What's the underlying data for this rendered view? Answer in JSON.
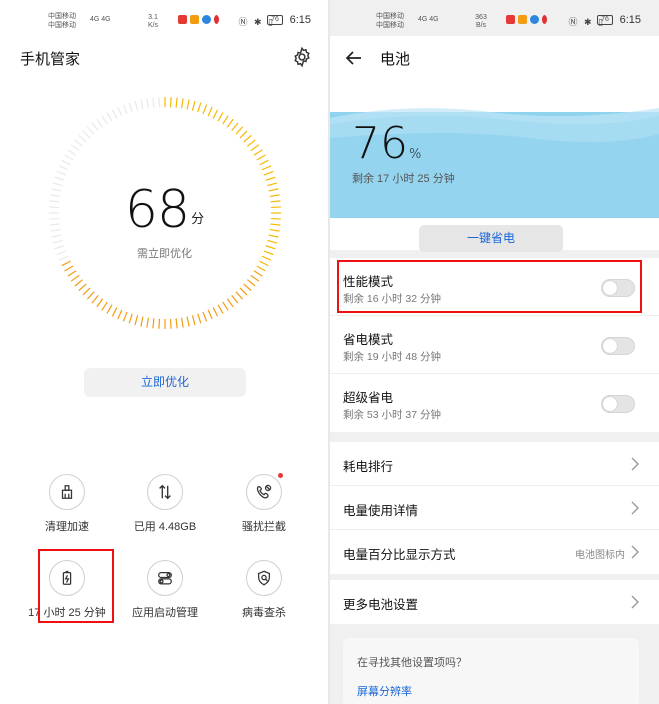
{
  "left": {
    "status": {
      "carrier_line1": "中国移动",
      "carrier_line2": "中国移动",
      "net": "4G 4G",
      "speed": "3.1\nK/s",
      "battery": "76",
      "time": "6:15"
    },
    "title": "手机管家",
    "score": {
      "value": "68",
      "unit": "分",
      "subtitle": "需立即优化"
    },
    "optimize_button": "立即优化",
    "tools": [
      {
        "label": "清理加速",
        "icon": "broom-icon"
      },
      {
        "label": "已用 4.48GB",
        "icon": "data-traffic-icon"
      },
      {
        "label": "骚扰拦截",
        "icon": "call-block-icon",
        "badge": true
      },
      {
        "label": "17 小时 25 分钟",
        "icon": "battery-icon"
      },
      {
        "label": "应用启动管理",
        "icon": "toggle-icon"
      },
      {
        "label": "病毒查杀",
        "icon": "shield-search-icon"
      }
    ],
    "score_ring": {
      "value": 68,
      "max": 100,
      "color_start": "#f5b800",
      "color_end": "#f39c12",
      "track_color": "#e9e9e9"
    }
  },
  "right": {
    "status": {
      "carrier_line1": "中国移动",
      "carrier_line2": "中国移动",
      "net": "4G 4G",
      "speed": "363\nB/s",
      "battery": "76",
      "time": "6:15"
    },
    "title": "电池",
    "battery_percent": "76",
    "percent_unit": "%",
    "remaining": "剩余 17 小时 25 分钟",
    "save_button": "一键省电",
    "modes": [
      {
        "title": "性能模式",
        "subtitle": "剩余 16 小时 32 分钟",
        "enabled": false
      },
      {
        "title": "省电模式",
        "subtitle": "剩余 19 小时 48 分钟",
        "enabled": false
      },
      {
        "title": "超级省电",
        "subtitle": "剩余 53 小时 37 分钟",
        "enabled": false
      }
    ],
    "nav": [
      {
        "title": "耗电排行",
        "value": ""
      },
      {
        "title": "电量使用详情",
        "value": ""
      },
      {
        "title": "电量百分比显示方式",
        "value": "电池图标内"
      }
    ],
    "more": "更多电池设置",
    "search": {
      "question": "在寻找其他设置项吗？",
      "link": "屏幕分辨率"
    },
    "accent_color": "#1a66d6",
    "wave_color": "#8fd3ef"
  }
}
